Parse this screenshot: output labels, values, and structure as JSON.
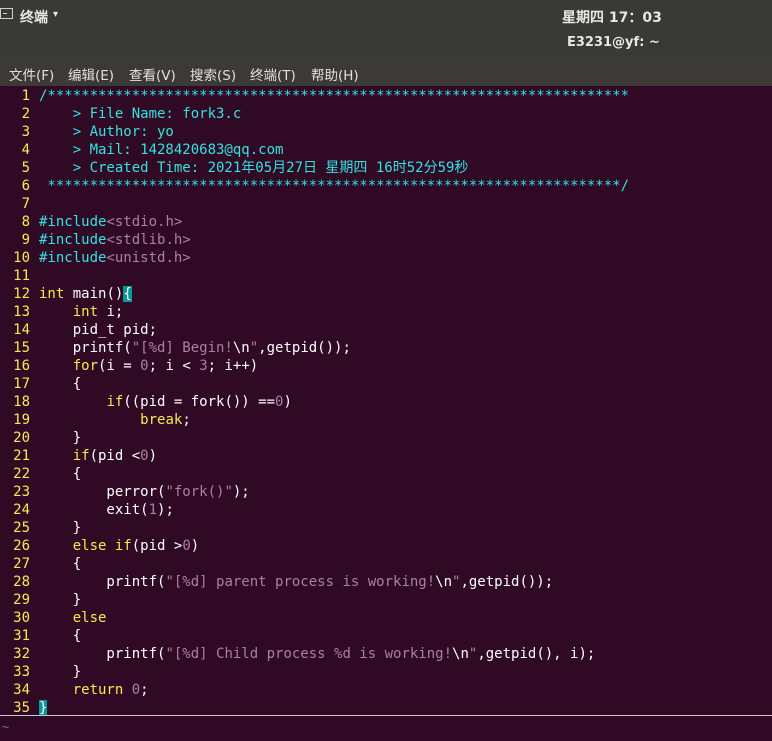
{
  "panel": {
    "app_icon": "terminal-icon",
    "app_name": "终端",
    "caret": "▾",
    "clock": "星期四 17：03"
  },
  "window": {
    "title": "E3231@yf: ~"
  },
  "menu": [
    "文件(F)",
    "编辑(E)",
    "查看(V)",
    "搜索(S)",
    "终端(T)",
    "帮助(H)"
  ],
  "editor": {
    "line_numbers": [
      "1",
      "2",
      "3",
      "4",
      "5",
      "6",
      "7",
      "8",
      "9",
      "10",
      "11",
      "12",
      "13",
      "14",
      "15",
      "16",
      "17",
      "18",
      "19",
      "20",
      "21",
      "22",
      "23",
      "24",
      "25",
      "26",
      "27",
      "28",
      "29",
      "30",
      "31",
      "32",
      "33",
      "34",
      "35"
    ],
    "tokens": {
      "l1": "/*********************************************************************",
      "l2": "    > File Name: fork3.c",
      "l3": "    > Author: yo",
      "l4": "    > Mail: 1428420683@qq.com",
      "l5": "    > Created Time: 2021年05月27日 星期四 16时52分59秒",
      "l6": " ********************************************************************/",
      "l8a": "#include",
      "l8b": "<stdio.h>",
      "l9a": "#include",
      "l9b": "<stdlib.h>",
      "l10a": "#include",
      "l10b": "<unistd.h>",
      "l12a": "int",
      "l12b": " main()",
      "l12c": "{",
      "l13a": "    ",
      "l13b": "int",
      "l13c": " i;",
      "l14": "    pid_t pid;",
      "l15a": "    printf(",
      "l15b": "\"[%d] Begin!",
      "l15c": "\\n",
      "l15d": "\"",
      "l15e": ",getpid());",
      "l16a": "    ",
      "l16b": "for",
      "l16c": "(i = ",
      "l16d": "0",
      "l16e": "; i < ",
      "l16f": "3",
      "l16g": "; i++)",
      "l17": "    {",
      "l18a": "        ",
      "l18b": "if",
      "l18c": "((pid = fork()) ==",
      "l18d": "0",
      "l18e": ")",
      "l19a": "            ",
      "l19b": "break",
      "l19c": ";",
      "l20": "    }",
      "l21a": "    ",
      "l21b": "if",
      "l21c": "(pid <",
      "l21d": "0",
      "l21e": ")",
      "l22": "    {",
      "l23a": "        perror(",
      "l23b": "\"fork()\"",
      "l23c": ");",
      "l24a": "        exit(",
      "l24b": "1",
      "l24c": ");",
      "l25": "    }",
      "l26a": "    ",
      "l26b": "else if",
      "l26c": "(pid >",
      "l26d": "0",
      "l26e": ")",
      "l27": "    {",
      "l28a": "        printf(",
      "l28b": "\"[%d] parent process is working!",
      "l28c": "\\n",
      "l28d": "\"",
      "l28e": ",getpid());",
      "l29": "    }",
      "l30a": "    ",
      "l30b": "else",
      "l31": "    {",
      "l32a": "        printf(",
      "l32b": "\"[%d] Child process %d is working!",
      "l32c": "\\n",
      "l32d": "\"",
      "l32e": ",getpid(), i);",
      "l33": "    }",
      "l34a": "    ",
      "l34b": "return",
      "l34c": " ",
      "l34d": "0",
      "l34e": ";",
      "l35": "}"
    },
    "empty_line_marker": "~"
  }
}
